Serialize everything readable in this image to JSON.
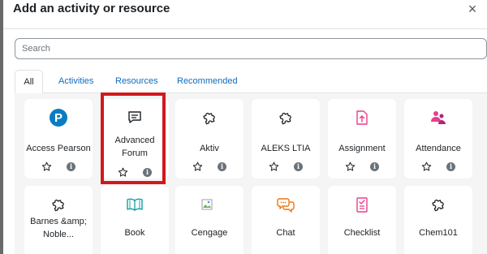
{
  "dialog": {
    "title": "Add an activity or resource",
    "close_glyph": "×"
  },
  "search": {
    "placeholder": "Search",
    "value": ""
  },
  "tabs": [
    {
      "label": "All",
      "active": true
    },
    {
      "label": "Activities",
      "active": false
    },
    {
      "label": "Resources",
      "active": false
    },
    {
      "label": "Recommended",
      "active": false
    }
  ],
  "modules": [
    {
      "label": "Access Pearson",
      "icon": "pearson-logo-icon"
    },
    {
      "label": "Advanced Forum",
      "icon": "forum-icon",
      "highlighted": true
    },
    {
      "label": "Aktiv",
      "icon": "puzzle-icon"
    },
    {
      "label": "ALEKS LTIA",
      "icon": "puzzle-icon"
    },
    {
      "label": "Assignment",
      "icon": "assignment-icon"
    },
    {
      "label": "Attendance",
      "icon": "attendance-icon"
    },
    {
      "label": "Barnes &amp; Noble...",
      "icon": "puzzle-icon"
    },
    {
      "label": "Book",
      "icon": "book-icon"
    },
    {
      "label": "Cengage",
      "icon": "broken-image-icon"
    },
    {
      "label": "Chat",
      "icon": "chat-icon"
    },
    {
      "label": "Checklist",
      "icon": "checklist-icon"
    },
    {
      "label": "Chem101",
      "icon": "puzzle-icon"
    }
  ],
  "colors": {
    "link_blue": "#0f6cbf",
    "pearson_blue": "#0a7cc1",
    "activity_pink": "#e83e8c",
    "activity_teal": "#11a0a8",
    "activity_orange": "#f0750f",
    "highlight_red": "#d1191b"
  }
}
